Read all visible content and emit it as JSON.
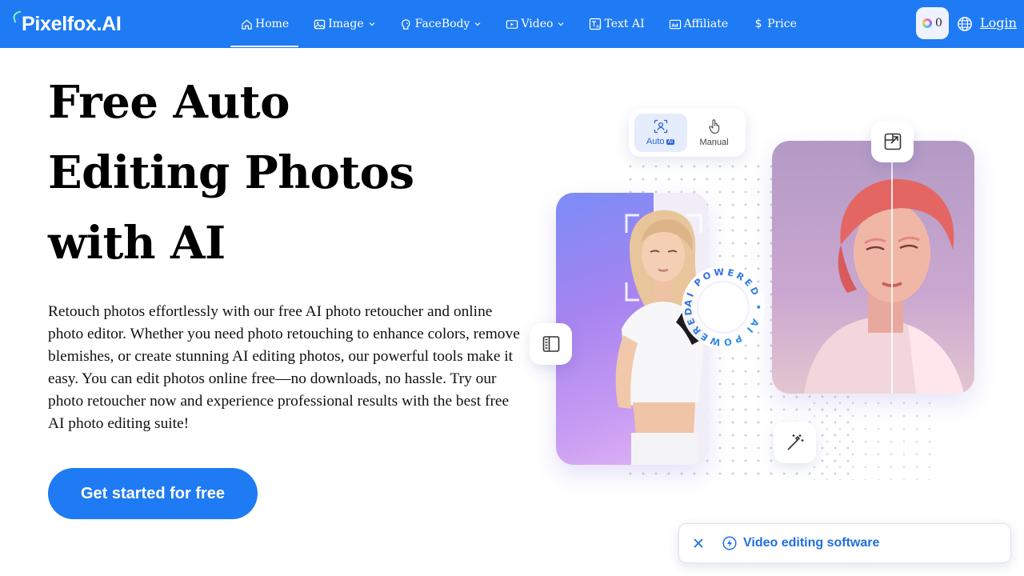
{
  "brand": {
    "name": "Pixelfox.AI",
    "primary_color": "#1f7bf3"
  },
  "nav": {
    "items": [
      {
        "label": "Home",
        "icon": "home-icon",
        "dropdown": false,
        "active": true
      },
      {
        "label": "Image",
        "icon": "image-icon",
        "dropdown": true,
        "active": false
      },
      {
        "label": "FaceBody",
        "icon": "face-icon",
        "dropdown": true,
        "active": false
      },
      {
        "label": "Video",
        "icon": "video-icon",
        "dropdown": true,
        "active": false
      },
      {
        "label": "Text AI",
        "icon": "text-ai-icon",
        "dropdown": false,
        "active": false
      },
      {
        "label": "Affiliate",
        "icon": "affiliate-icon",
        "dropdown": false,
        "active": false
      },
      {
        "label": "Price",
        "icon": "dollar-icon",
        "dropdown": false,
        "active": false
      }
    ],
    "credits": "0",
    "login_label": "Login"
  },
  "hero": {
    "title_lines": [
      "Free Auto",
      "Editing Photos",
      "with AI"
    ],
    "description": "Retouch photos effortlessly with our free AI photo retoucher and online photo editor. Whether you need photo retouching to enhance colors, remove blemishes, or create stunning AI editing photos, our powerful tools make it easy. You can edit photos online free—no downloads, no hassle. Try our photo retoucher now and experience professional results with the best free AI photo editing suite!",
    "cta_label": "Get started for free"
  },
  "illustration": {
    "toggle": {
      "auto_label": "Auto",
      "auto_badge": "AI",
      "manual_label": "Manual",
      "selected": "Auto"
    },
    "badge_text": "AI POWERED • AI POWERED •"
  },
  "toast": {
    "text": "Video editing software"
  }
}
